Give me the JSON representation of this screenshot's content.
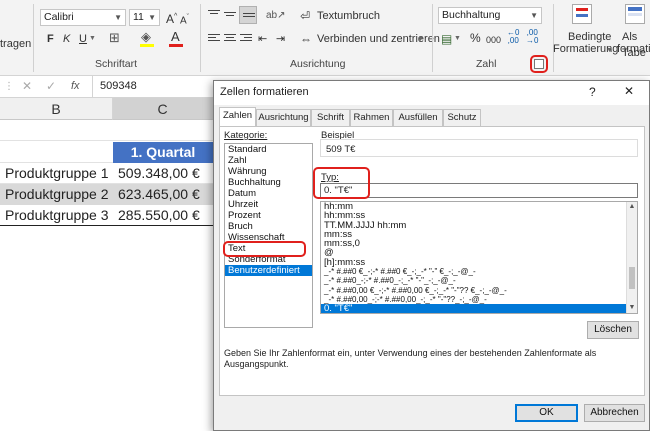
{
  "ribbon": {
    "paste_partial": "tragen",
    "font_name": "Calibri",
    "font_size": "11",
    "font_group_label": "Schriftart",
    "bold": "F",
    "italic": "K",
    "underline": "U",
    "wrap_text": "Textumbruch",
    "merge_center": "Verbinden und zentrieren",
    "align_group_label": "Ausrichtung",
    "number_format": "Buchhaltung",
    "number_group_label": "Zahl",
    "percent": "%",
    "thousands": "000",
    "cond_format_line1": "Bedingte",
    "cond_format_line2": "Formatierung",
    "table_format_line1": "Als Tabe",
    "table_format_line2": "formatier"
  },
  "formula_bar": {
    "value": "509348",
    "fx": "fx"
  },
  "sheet": {
    "col_b": "B",
    "col_c": "C",
    "header": "1. Quartal",
    "rows": [
      {
        "name": "Produktgruppe 1",
        "value": "509.348,00 €"
      },
      {
        "name": "Produktgruppe 2",
        "value": "623.465,00 €"
      },
      {
        "name": "Produktgruppe 3",
        "value": "285.550,00 €"
      }
    ],
    "header_color": "#4472c4"
  },
  "dialog": {
    "title": "Zellen formatieren",
    "help": "?",
    "close": "✕",
    "tabs": [
      "Zahlen",
      "Ausrichtung",
      "Schrift",
      "Rahmen",
      "Ausfüllen",
      "Schutz"
    ],
    "category_label": "Kategorie:",
    "categories": [
      "Standard",
      "Zahl",
      "Währung",
      "Buchhaltung",
      "Datum",
      "Uhrzeit",
      "Prozent",
      "Bruch",
      "Wissenschaft",
      "Text",
      "Sonderformat",
      "Benutzerdefiniert"
    ],
    "selected_category": "Benutzerdefiniert",
    "example_label": "Beispiel",
    "example_value": "509 T€",
    "type_label": "Typ:",
    "type_value": "0. \"T€\"",
    "formats": [
      "hh:mm",
      "hh:mm:ss",
      "TT.MM.JJJJ hh:mm",
      "mm:ss",
      "mm:ss,0",
      "@",
      "[h]:mm:ss",
      "_-* #.##0 €_-;-* #.##0 €_-;_-* \"-\" €_-;_-@_-",
      "_-* #.##0_-;-* #.##0_-;_-* \"-\"_-;_-@_-",
      "_-* #.##0,00 €_-;-* #.##0,00 €_-;_-* \"-\"?? €_-;_-@_-",
      "_-* #.##0,00_-;-* #.##0,00_-;_-* \"-\"??_-;_-@_-",
      "0. \"T€\""
    ],
    "selected_format": "0. \"T€\"",
    "delete_button": "Löschen",
    "hint": "Geben Sie Ihr Zahlenformat ein, unter Verwendung eines der bestehenden Zahlenformate als Ausgangspunkt.",
    "ok_button": "OK",
    "cancel_button": "Abbrechen"
  },
  "colors": {
    "accent": "#0078d7",
    "highlight_red": "#e0201c"
  }
}
